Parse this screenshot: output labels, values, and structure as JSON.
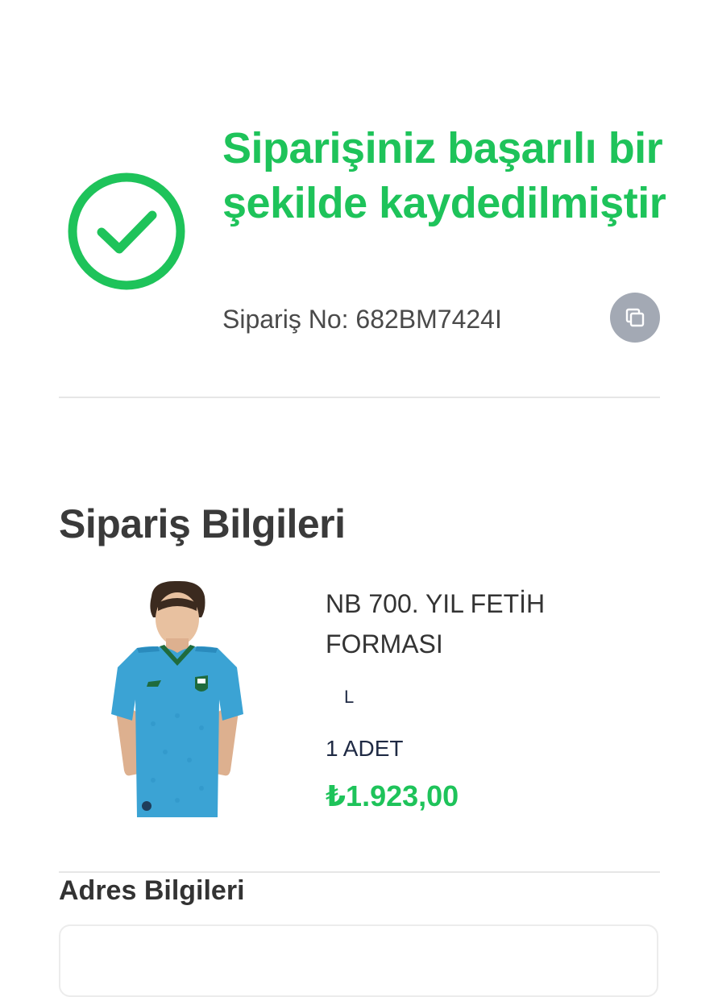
{
  "success": {
    "icon": "check-circle-icon",
    "title": "Siparişiniz başarılı bir şekilde kaydedilmiştir",
    "order_no": "Sipariş No: 682BM7424I",
    "copy_icon": "copy-icon",
    "accent_color": "#1ec35a"
  },
  "order_info": {
    "title": "Sipariş Bilgileri",
    "product": {
      "name": "NB 700. YIL FETİH FORMASI",
      "size": "L",
      "quantity": "1 ADET",
      "price": "₺1.923,00",
      "image_icon": "jersey-image"
    }
  },
  "address": {
    "title": "Adres Bilgileri"
  }
}
